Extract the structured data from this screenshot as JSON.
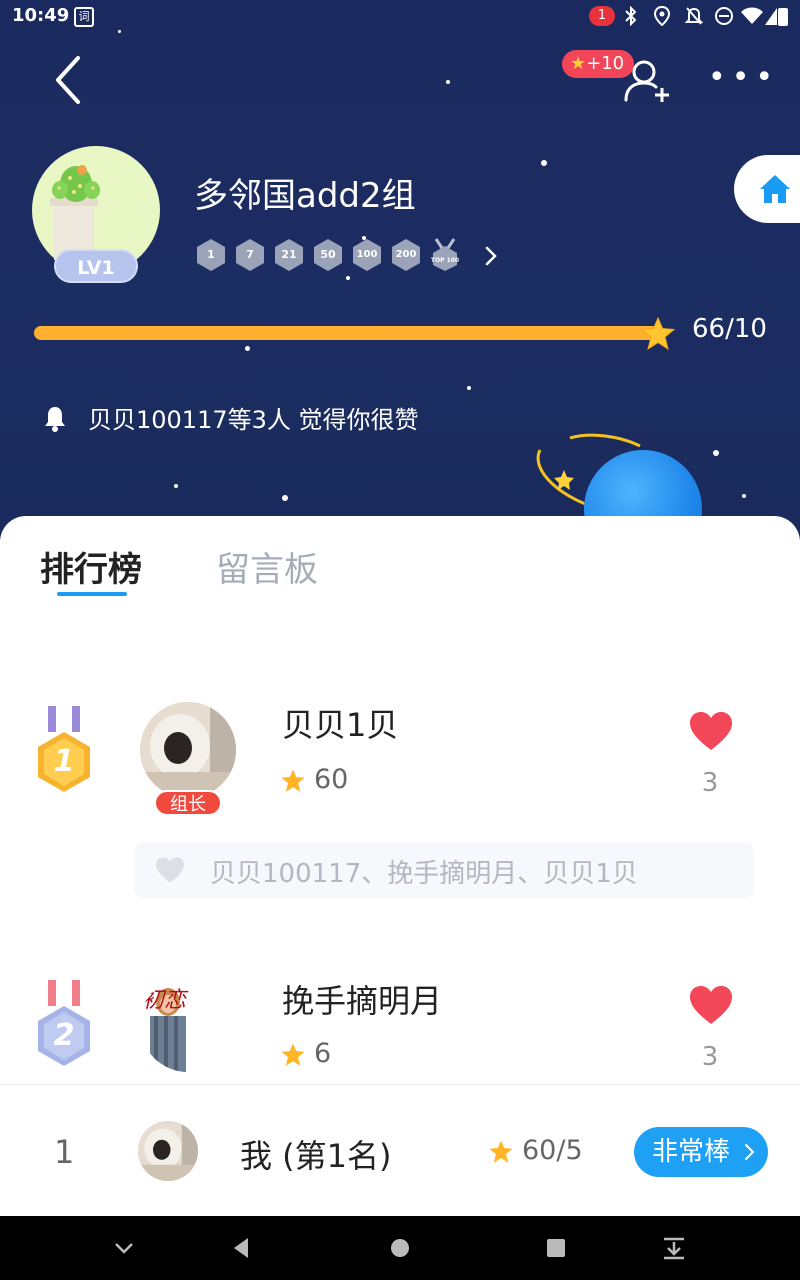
{
  "status_bar": {
    "time": "10:49",
    "app_icon_glyph": "词",
    "notification_count": "1",
    "icons": [
      "bluetooth-icon",
      "location-icon",
      "bell-off-icon",
      "dnd-icon",
      "wifi-icon",
      "signal-icon",
      "battery-icon"
    ]
  },
  "header": {
    "reward_badge": "+10",
    "more_label": "•••",
    "group_name": "多邻国add2组",
    "level": "LV1",
    "medals": [
      "1",
      "7",
      "21",
      "50",
      "100",
      "200",
      "TOP 100"
    ],
    "progress_text": "66/10",
    "progress_value": 1.0,
    "notice": "贝贝100117等3人 觉得你很赞"
  },
  "tabs": {
    "active": "排行榜",
    "inactive": "留言板"
  },
  "ranking": [
    {
      "rank": "1",
      "name": "贝贝1贝",
      "score": "60",
      "likes": "3",
      "tag": "组长",
      "likers": "贝贝100117、挽手摘明月、贝贝1贝"
    },
    {
      "rank": "2",
      "name": "挽手摘明月",
      "score": "6",
      "likes": "3",
      "avatar_text": "初恋"
    }
  ],
  "my_bar": {
    "rank": "1",
    "name": "我 (第1名)",
    "score": "60/5",
    "button": "非常棒"
  },
  "colors": {
    "hero_bg": "#1b2a5e",
    "accent_blue": "#1ea0f5",
    "progress": "#ffb02e",
    "heart": "#f2485a",
    "leader_tag": "#f04a3e"
  }
}
